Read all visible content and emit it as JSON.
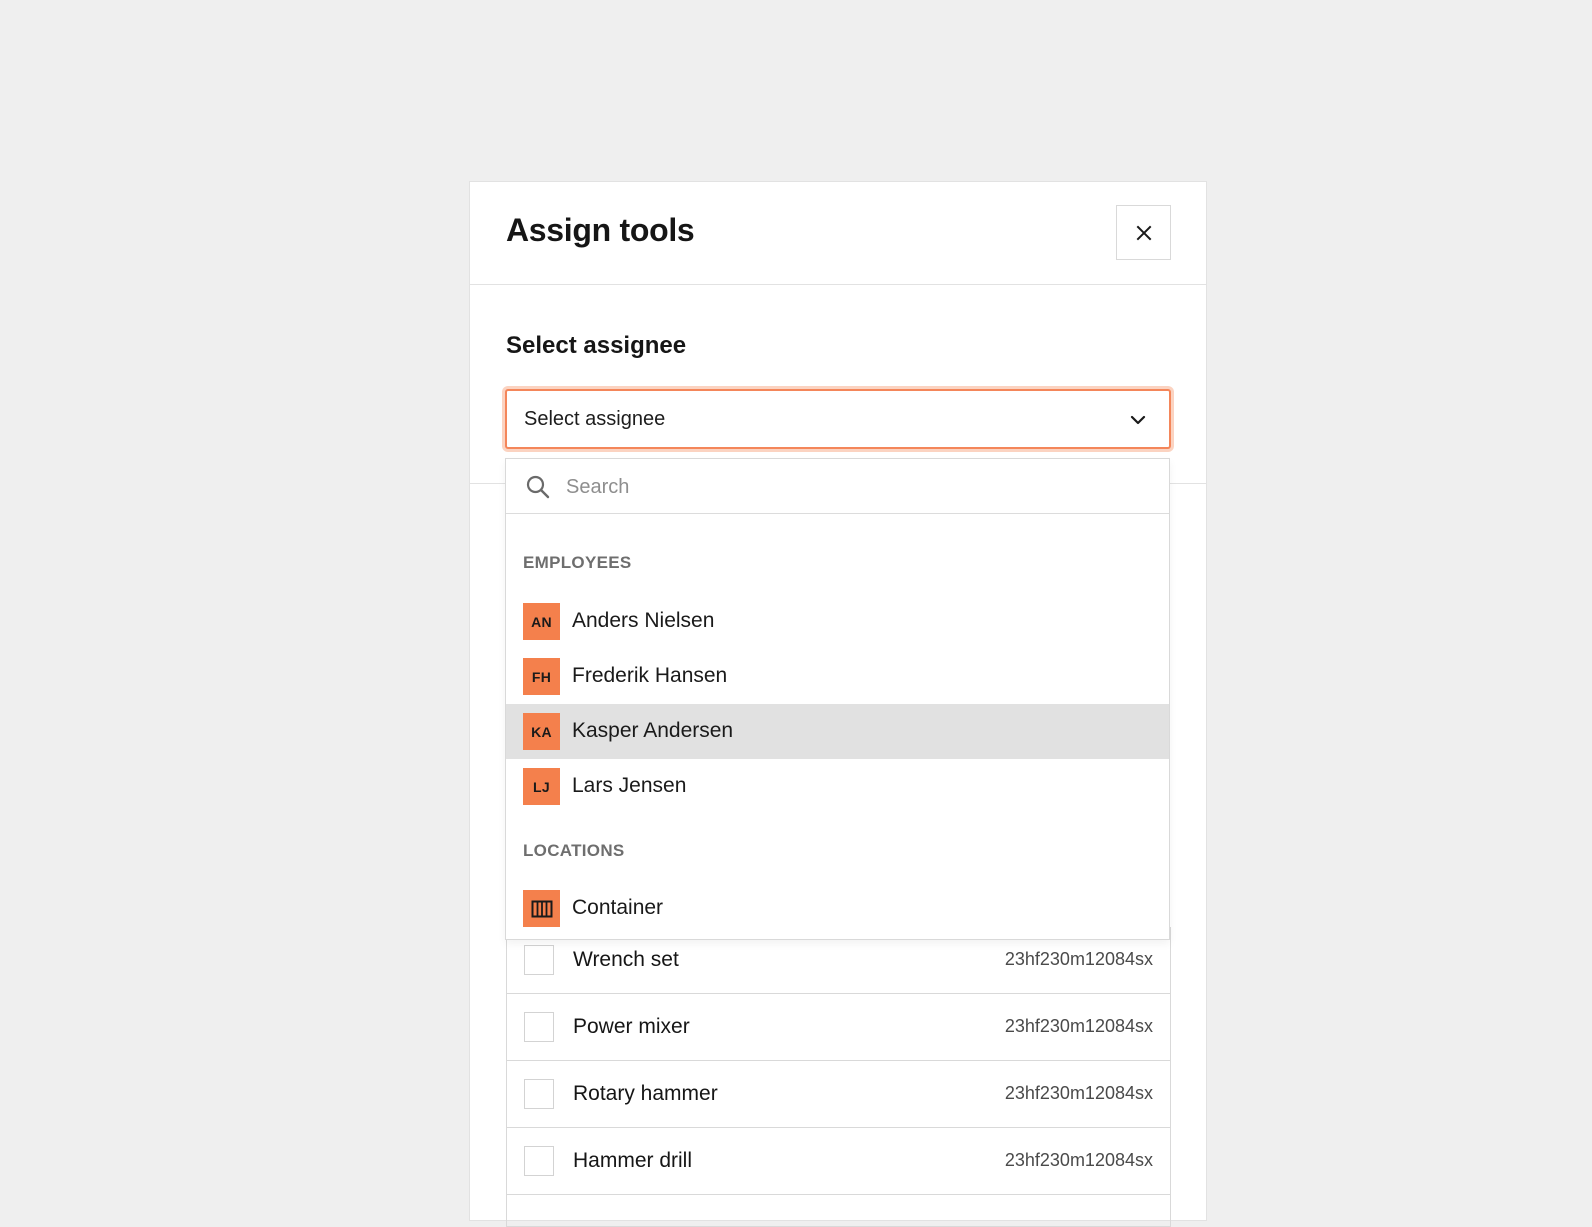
{
  "modal": {
    "title": "Assign tools",
    "close_label": "close"
  },
  "assignee": {
    "section_label": "Select assignee",
    "select_value": "Select assignee"
  },
  "dropdown": {
    "search_placeholder": "Search",
    "groups": [
      {
        "heading": "EMPLOYEES",
        "options": [
          {
            "initials": "AN",
            "label": "Anders Nielsen",
            "highlighted": false
          },
          {
            "initials": "FH",
            "label": "Frederik Hansen",
            "highlighted": false
          },
          {
            "initials": "KA",
            "label": "Kasper Andersen",
            "highlighted": true
          },
          {
            "initials": "LJ",
            "label": "Lars Jensen",
            "highlighted": false
          }
        ]
      },
      {
        "heading": "LOCATIONS",
        "options": [
          {
            "icon": "container-icon",
            "label": "Container",
            "highlighted": false
          }
        ]
      }
    ]
  },
  "tools": [
    {
      "name": "Wrench set",
      "code": "23hf230m12084sx",
      "checked": false
    },
    {
      "name": "Power mixer",
      "code": "23hf230m12084sx",
      "checked": false
    },
    {
      "name": "Rotary hammer",
      "code": "23hf230m12084sx",
      "checked": false
    },
    {
      "name": "Hammer drill",
      "code": "23hf230m12084sx",
      "checked": false
    }
  ],
  "colors": {
    "accent": "#f4804c",
    "focus_border": "#f4865a",
    "highlight_row": "#e1e1e1",
    "background": "#efefef"
  }
}
